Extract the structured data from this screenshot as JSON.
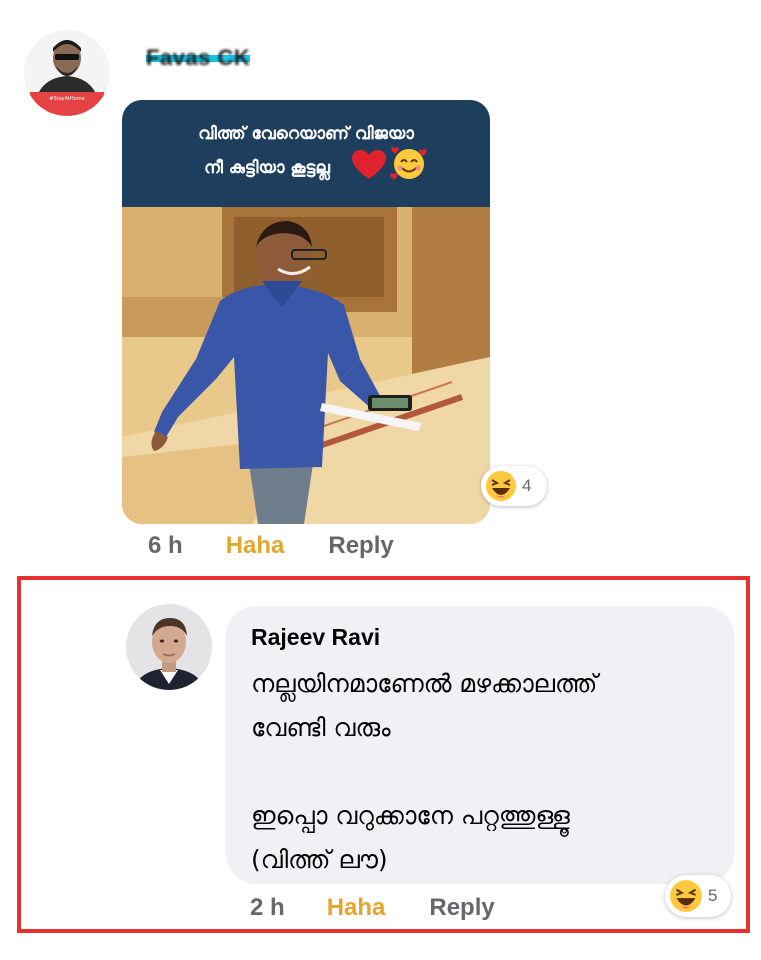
{
  "comment1": {
    "author": "Favas CK",
    "meme_caption_line1": "വിത്ത് വേറെയാണ് വിജയാ",
    "meme_caption_line2": "നീ കുട്ടിയാ കൂട്ടല്ല",
    "avatar_badge": "#StayAtHome",
    "reaction_icon": "haha-emoji-icon",
    "reaction_count": "4",
    "time": "6 h",
    "haha_label": "Haha",
    "reply_label": "Reply"
  },
  "reply1": {
    "author": "Rajeev Ravi",
    "text": "നല്ലയിനമാണേൽ മഴക്കാലത്ത്\nവേണ്ടി വരും\n\nഇപ്പൊ വറുക്കാനേ പറ്റത്തുള്ളൂ\n(വിത്ത് ലൗ)",
    "reaction_icon": "haha-emoji-icon",
    "reaction_count": "5",
    "time": "2 h",
    "haha_label": "Haha",
    "reply_label": "Reply",
    "highlight_color": "#e7312e"
  },
  "colors": {
    "haha": "#e4a52b",
    "meta": "#65676b",
    "bubble": "#eff1f4",
    "meme_header": "#1d3e5d"
  }
}
